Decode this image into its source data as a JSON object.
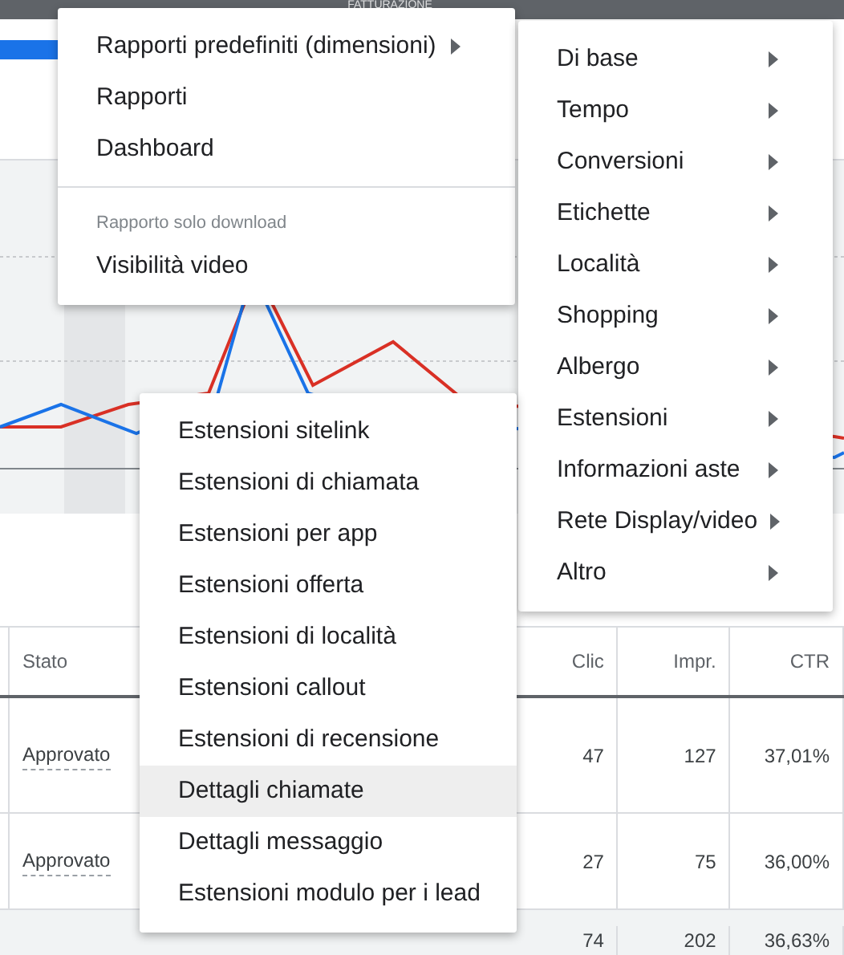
{
  "top_bar": {
    "title": "FATTURAZIONE"
  },
  "table": {
    "columns": [
      "Stato",
      null,
      null,
      "Clic",
      "Impr.",
      "CTR"
    ],
    "rows": [
      {
        "cells": [
          "Approvato",
          null,
          null,
          "47",
          "127",
          "37,01%"
        ]
      },
      {
        "cells": [
          "Approvato",
          null,
          null,
          "27",
          "75",
          "36,00%"
        ]
      }
    ],
    "total": {
      "cells": [
        null,
        null,
        null,
        "74",
        "202",
        "36,63%"
      ]
    }
  },
  "report_menu": {
    "items": [
      {
        "kind": "submenu",
        "label": "Rapporti predefiniti (dimensioni)"
      },
      {
        "kind": "item",
        "label": "Rapporti"
      },
      {
        "kind": "item",
        "label": "Dashboard"
      },
      {
        "kind": "divider"
      },
      {
        "kind": "header",
        "label": "Rapporto solo download"
      },
      {
        "kind": "item",
        "label": "Visibilità video"
      }
    ]
  },
  "dimensions_menu": {
    "items": [
      {
        "kind": "submenu",
        "label": "Di base"
      },
      {
        "kind": "submenu",
        "label": "Tempo"
      },
      {
        "kind": "submenu",
        "label": "Conversioni"
      },
      {
        "kind": "submenu",
        "label": "Etichette"
      },
      {
        "kind": "submenu",
        "label": "Località"
      },
      {
        "kind": "submenu",
        "label": "Shopping"
      },
      {
        "kind": "submenu",
        "label": "Albergo"
      },
      {
        "kind": "submenu",
        "label": "Estensioni"
      },
      {
        "kind": "submenu",
        "label": "Informazioni aste"
      },
      {
        "kind": "submenu",
        "label": "Rete Display/video"
      },
      {
        "kind": "submenu",
        "label": "Altro"
      }
    ]
  },
  "extensions_menu": {
    "items": [
      {
        "label": "Estensioni sitelink",
        "highlighted": false
      },
      {
        "label": "Estensioni di chiamata",
        "highlighted": false
      },
      {
        "label": "Estensioni per app",
        "highlighted": false
      },
      {
        "label": "Estensioni offerta",
        "highlighted": false
      },
      {
        "label": "Estensioni di località",
        "highlighted": false
      },
      {
        "label": "Estensioni callout",
        "highlighted": false
      },
      {
        "label": "Estensioni di recensione",
        "highlighted": false
      },
      {
        "label": "Dettagli chiamate",
        "highlighted": true
      },
      {
        "label": "Dettagli messaggio",
        "highlighted": false
      },
      {
        "label": "Estensioni modulo per i lead",
        "highlighted": false
      }
    ]
  }
}
